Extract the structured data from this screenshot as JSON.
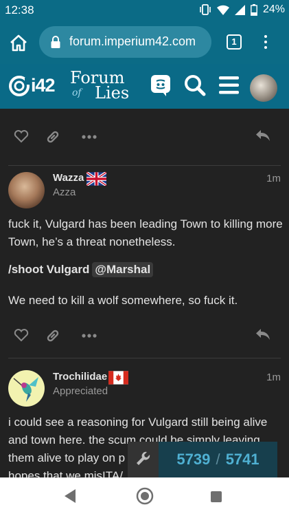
{
  "status_bar": {
    "time": "12:38",
    "battery": "24%"
  },
  "browser": {
    "url": "forum.imperium42.com",
    "tab_count": "1"
  },
  "site": {
    "logo_short": "i42",
    "logo_line1": "Forum",
    "logo_line2a": "of",
    "logo_line2b": "Lies"
  },
  "posts": [
    {
      "username": "Wazza",
      "user_title": "Azza",
      "flag": "uk",
      "age": "1m",
      "paragraphs": [
        "fuck it, Vulgard has been leading Town to killing more Town, he’s a threat nonetheless.",
        "We need to kill a wolf somewhere, so fuck it."
      ],
      "command": "/shoot Vulgard",
      "mention": "@Marshal"
    },
    {
      "username": "Trochilidae",
      "user_title": "Appreciated",
      "flag": "canada",
      "age": "1m",
      "body_line1": "i could see a reasoning for Vulgard still being alive",
      "body_line2": "and town here. the scum could be simply leaving",
      "body_line3": "them alive to play on p",
      "body_line4": "hopes that we misITA/"
    }
  ],
  "progress": {
    "current": "5739",
    "separator": "/",
    "total": "5741"
  },
  "colors": {
    "header": "#0a6a87",
    "background": "#222222",
    "progress_text": "#4fb0d2"
  }
}
